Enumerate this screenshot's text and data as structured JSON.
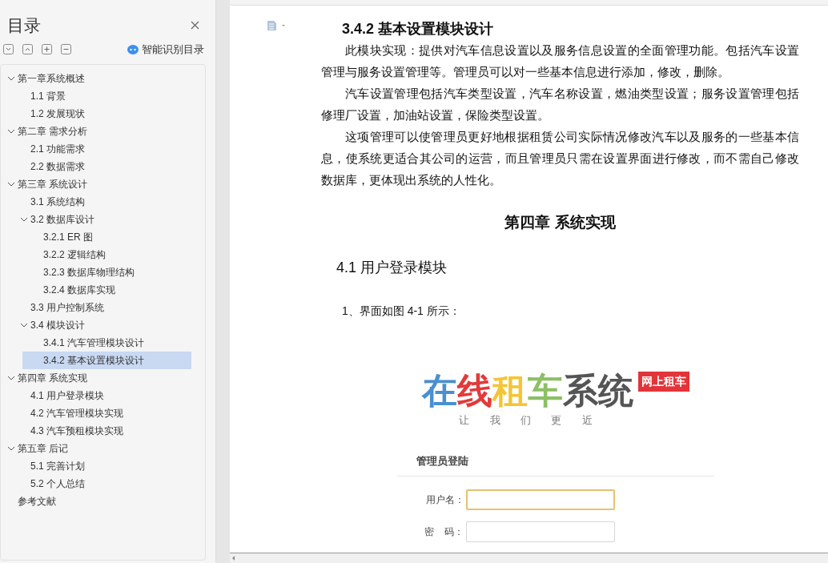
{
  "sidebar": {
    "title": "目录",
    "ai_button": "智能识别目录",
    "toc": [
      {
        "label": "第一章系统概述",
        "expanded": true,
        "selected": false,
        "children": [
          {
            "label": "1.1 背景",
            "selected": false
          },
          {
            "label": "1.2 发展现状",
            "selected": false
          }
        ]
      },
      {
        "label": "第二章  需求分析",
        "expanded": true,
        "selected": false,
        "children": [
          {
            "label": "2.1  功能需求",
            "selected": false
          },
          {
            "label": "2.2  数据需求",
            "selected": false
          }
        ]
      },
      {
        "label": "第三章  系统设计",
        "expanded": true,
        "selected": false,
        "children": [
          {
            "label": "3.1 系统结构",
            "selected": false
          },
          {
            "label": "3.2  数据库设计",
            "expanded": true,
            "selected": false,
            "children": [
              {
                "label": "3.2.1 ER 图",
                "selected": false
              },
              {
                "label": "3.2.2  逻辑结构",
                "selected": false
              },
              {
                "label": "3.2.3  数据库物理结构",
                "selected": false
              },
              {
                "label": "3.2.4  数据库实现",
                "selected": false
              }
            ]
          },
          {
            "label": "3.3 用户控制系统",
            "selected": false
          },
          {
            "label": "3.4 模块设计",
            "expanded": true,
            "selected": false,
            "children": [
              {
                "label": "3.4.1  汽车管理模块设计",
                "selected": false
              },
              {
                "label": "3.4.2  基本设置模块设计",
                "selected": true
              }
            ]
          }
        ]
      },
      {
        "label": "第四章  系统实现",
        "expanded": true,
        "selected": false,
        "children": [
          {
            "label": "4.1 用户登录模块",
            "selected": false
          },
          {
            "label": "4.2 汽车管理模块实现",
            "selected": false
          },
          {
            "label": "4.3 汽车预租模块实现",
            "selected": false
          }
        ]
      },
      {
        "label": "第五章  后记",
        "expanded": true,
        "selected": false,
        "children": [
          {
            "label": "5.1 完善计划",
            "selected": false
          },
          {
            "label": "5.2 个人总结",
            "selected": false
          }
        ]
      },
      {
        "label": "参考文献",
        "selected": false
      }
    ]
  },
  "document": {
    "section_heading": "3.4.2  基本设置模块设计",
    "paragraphs": [
      "此模块实现：提供对汽车信息设置以及服务信息设置的全面管理功能。包括汽车设置管理与服务设置管理等。管理员可以对一些基本信息进行添加，修改，删除。",
      "汽车设置管理包括汽车类型设置，汽车名称设置，燃油类型设置；服务设置管理包括修理厂设置，加油站设置，保险类型设置。",
      "这项管理可以使管理员更好地根据租赁公司实际情况修改汽车以及服务的一些基本信息，使系统更适合其公司的运营，而且管理员只需在设置界面进行修改，而不需自己修改数据库，更体现出系统的人性化。"
    ],
    "chapter_heading": "第四章  系统实现",
    "subsection_heading": "4.1 用户登录模块",
    "caption_line": "1、界面如图 4-1 所示：",
    "figure": {
      "logo_chars": [
        {
          "text": "在",
          "color": "#4a8fd0"
        },
        {
          "text": "线",
          "color": "#e33a3a"
        },
        {
          "text": "租",
          "color": "#f4c534"
        },
        {
          "text": "车",
          "color": "#8cc063"
        },
        {
          "text": "系统",
          "color": "#555555"
        }
      ],
      "badge": "网上租车",
      "tagline": "让 我 们 更 近",
      "login_title": "管理员登陆",
      "fields": [
        {
          "label": "用户名：",
          "focused": true
        },
        {
          "label": "密    码：",
          "focused": false
        }
      ]
    }
  }
}
